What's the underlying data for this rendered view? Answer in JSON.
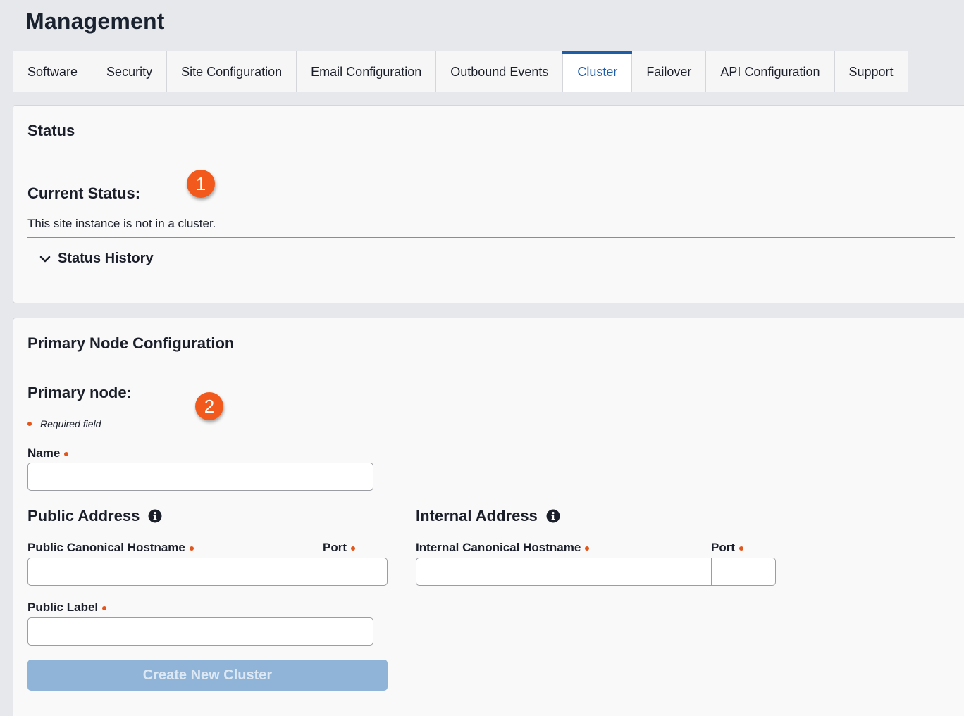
{
  "page": {
    "title": "Management"
  },
  "tabs": [
    {
      "label": "Software"
    },
    {
      "label": "Security"
    },
    {
      "label": "Site Configuration"
    },
    {
      "label": "Email Configuration"
    },
    {
      "label": "Outbound Events"
    },
    {
      "label": "Cluster",
      "active": true
    },
    {
      "label": "Failover"
    },
    {
      "label": "API Configuration"
    },
    {
      "label": "Support"
    }
  ],
  "status_section": {
    "title": "Status",
    "current_status_label": "Current Status:",
    "current_status_text": "This site instance is not in a cluster.",
    "history_label": "Status History",
    "badge": "1"
  },
  "primary_section": {
    "title": "Primary Node Configuration",
    "primary_node_label": "Primary node:",
    "required_note": "Required field",
    "badge": "2",
    "name_label": "Name",
    "name_value": "",
    "public_address": {
      "title": "Public Address",
      "hostname_label": "Public Canonical Hostname",
      "hostname_value": "",
      "port_label": "Port",
      "port_value": "",
      "label_label": "Public Label",
      "label_value": ""
    },
    "internal_address": {
      "title": "Internal Address",
      "hostname_label": "Internal Canonical Hostname",
      "hostname_value": "",
      "port_label": "Port",
      "port_value": ""
    },
    "create_button": "Create New Cluster",
    "create_button_enabled": false
  },
  "colors": {
    "accent": "#1f5da6",
    "required": "#e2561b",
    "badge": "#f25a1d",
    "button_disabled": "#90b3d8"
  },
  "icons": [
    "chevron-down-icon",
    "info-icon"
  ]
}
